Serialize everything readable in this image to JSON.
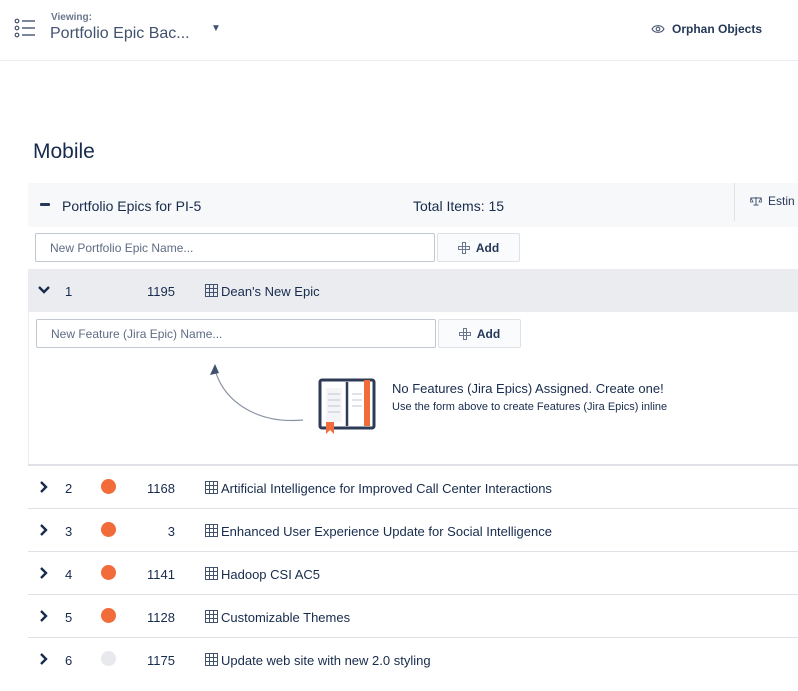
{
  "header": {
    "viewing_label": "Viewing:",
    "viewing_value": "Portfolio Epic Bac...",
    "orphan_label": "Orphan Objects"
  },
  "page": {
    "title": "Mobile"
  },
  "group": {
    "title": "Portfolio Epics for  PI-5",
    "total_items": "Total Items: 15",
    "estimate_label": "Estin"
  },
  "epic_input": {
    "placeholder": "New Portfolio Epic Name...",
    "add_label": "Add"
  },
  "feature_input": {
    "placeholder": "New Feature (Jira Epic) Name...",
    "add_label": "Add"
  },
  "empty_state": {
    "title": "No Features (Jira Epics) Assigned. Create one!",
    "subtitle": "Use the form above to create Features (Jira Epics) inline"
  },
  "colors": {
    "accent_orange": "#f26b3a",
    "dot_inactive": "#e8e9ec",
    "book_blue": "#2e3b57"
  },
  "rows": [
    {
      "rank": "1",
      "key": "1195",
      "title": "Dean's New Epic",
      "status": "none",
      "expanded": true
    },
    {
      "rank": "2",
      "key": "1168",
      "title": "Artificial Intelligence for Improved Call Center Interactions",
      "status": "orange",
      "expanded": false
    },
    {
      "rank": "3",
      "key": "3",
      "title": "Enhanced User Experience Update for Social Intelligence",
      "status": "orange",
      "expanded": false
    },
    {
      "rank": "4",
      "key": "1141",
      "title": "Hadoop CSI AC5",
      "status": "orange",
      "expanded": false
    },
    {
      "rank": "5",
      "key": "1128",
      "title": "Customizable Themes",
      "status": "orange",
      "expanded": false
    },
    {
      "rank": "6",
      "key": "1175",
      "title": "Update web site with new 2.0 styling",
      "status": "gray",
      "expanded": false
    }
  ]
}
